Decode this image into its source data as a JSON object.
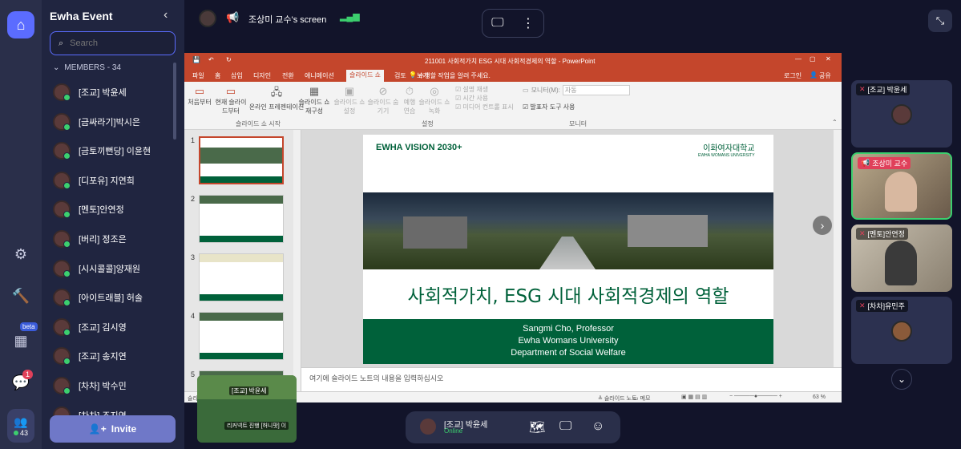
{
  "sidebar": {
    "space_name": "Ewha Event",
    "search_placeholder": "Search",
    "members_label": "MEMBERS - 34",
    "invite_label": "Invite",
    "members": [
      "[조교] 박윤세",
      "[금싸라기]박시은",
      "[금토끼뻔당] 이윤현",
      "[디포유] 지연희",
      "[멘토]안연정",
      "[버리] 정조은",
      "[시시콜콜]양재원",
      "[아이트래블] 허솔",
      "[조교] 김시영",
      "[조교] 송지연",
      "[차차] 박수민",
      "[차차] 조지연"
    ]
  },
  "rail": {
    "people_count": "43",
    "chat_badge": "1",
    "beta_label": "beta"
  },
  "stage": {
    "screen_title": "조상미 교수's screen"
  },
  "ppt": {
    "window_title": "211001 사회적가치 ESG 시대 사회적경제의 역할 - PowerPoint",
    "login": "로그인",
    "share": "공유",
    "tabs": [
      "파일",
      "홈",
      "삽입",
      "디자인",
      "전환",
      "애니메이션",
      "슬라이드 쇼",
      "검토",
      "보기"
    ],
    "tell_me": "수행할 작업을 알려 주세요.",
    "ribbon": {
      "from_start": "처음부터",
      "from_current": "현재 슬라이드부터",
      "online": "온라인 프레젠테이션",
      "custom": "슬라이드 쇼 재구성",
      "setup": "슬라이드 쇼 설정",
      "hide": "슬라이드 숨기기",
      "rehearse": "예행 연습",
      "record": "슬라이드 쇼 녹화",
      "cb_narration": "설명 재생",
      "cb_timing": "시간 사용",
      "cb_media": "미디어 컨트롤 표시",
      "monitor_label": "모니터(M):",
      "monitor_value": "자동",
      "presenter": "발표자 도구 사용",
      "group_start": "슬라이드 쇼 시작",
      "group_setup": "설정",
      "group_monitor": "모니터"
    },
    "thumbnails": [
      "1",
      "2",
      "3",
      "4",
      "5"
    ],
    "slide": {
      "vision_logo": "EWHA VISION 2030+",
      "univ_kr": "이화여자대학교",
      "univ_en": "EWHA WOMANS UNIVERSITY",
      "title": "사회적가치, ESG 시대 사회적경제의 역할",
      "author": "Sangmi Cho, Professor",
      "university": "Ewha Womans University",
      "department": "Department of Social Welfare"
    },
    "notes_placeholder": "여기에 슬라이드 노트의 내용을 입력하십시오",
    "status": {
      "slide_info": "슬라이드 1/5",
      "notes": "슬라이드 노트",
      "comments": "메모",
      "zoom": "63 %"
    }
  },
  "tiles": [
    {
      "name": "[조교] 박윤세"
    },
    {
      "name": "조상미 교수"
    },
    {
      "name": "[멘토]안연정"
    },
    {
      "name": "[차차]유민주"
    }
  ],
  "minimap": {
    "label1": "[조교] 박윤세",
    "label2": "리커넥트 진행 [허니팟] 이"
  },
  "bottombar": {
    "user_name": "[조교] 박윤세",
    "user_status": "Online"
  },
  "colors": {
    "accent": "#5b6cff",
    "ppt_red": "#c4462c",
    "ewha_green": "#00613a"
  }
}
